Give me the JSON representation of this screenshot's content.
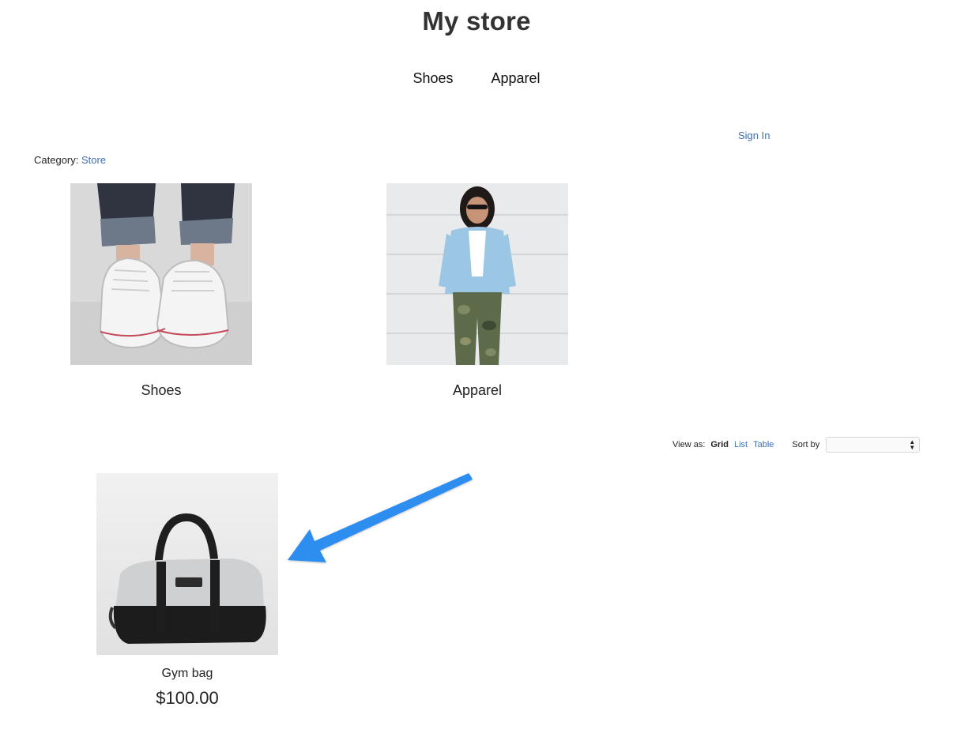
{
  "store": {
    "title": "My store"
  },
  "nav": {
    "items": [
      {
        "label": "Shoes"
      },
      {
        "label": "Apparel"
      }
    ]
  },
  "account": {
    "sign_in": "Sign In"
  },
  "breadcrumb": {
    "prefix": "Category:",
    "current": "Store"
  },
  "categories": [
    {
      "label": "Shoes",
      "image": "sneakers-photo"
    },
    {
      "label": "Apparel",
      "image": "woman-denim-shirt-photo"
    }
  ],
  "view_controls": {
    "view_as_label": "View as:",
    "options": [
      "Grid",
      "List",
      "Table"
    ],
    "selected": "Grid",
    "sort_label": "Sort by",
    "sort_value": ""
  },
  "products": [
    {
      "name": "Gym bag",
      "price": "$100.00",
      "image": "gym-bag-photo"
    }
  ],
  "annotation": {
    "arrow_color": "#2d8ef0",
    "points_to": "gym-bag-product"
  }
}
